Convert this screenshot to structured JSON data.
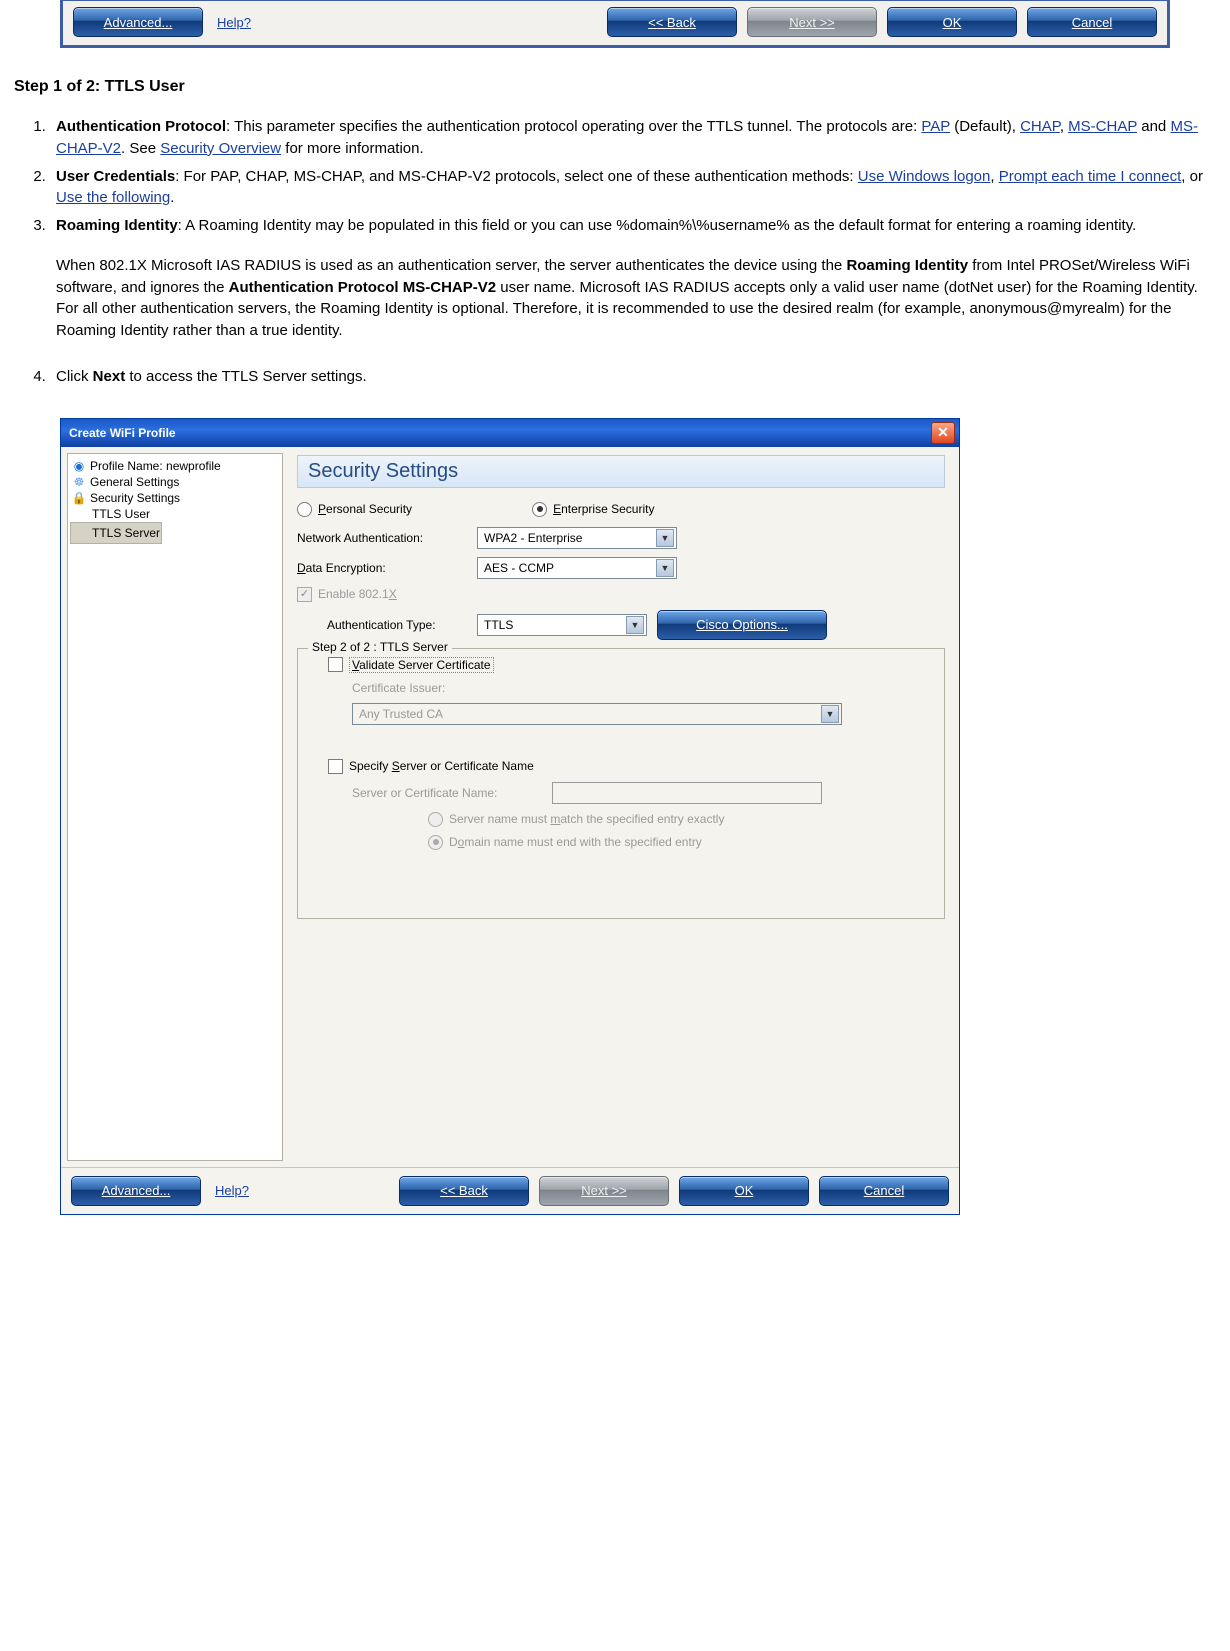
{
  "top_toolbar": {
    "advanced": "Advanced...",
    "help": "Help?",
    "back": "<< Back",
    "next": "Next >>",
    "ok": "OK",
    "cancel": "Cancel"
  },
  "doc": {
    "step_heading": "Step 1 of 2: TTLS User",
    "item1_label": "Authentication Protocol",
    "item1_text_a": ": This parameter specifies the authentication protocol operating over the TTLS tunnel. The protocols are: ",
    "item1_link_pap": "PAP",
    "item1_text_b": " (Default), ",
    "item1_link_chap": "CHAP",
    "item1_text_c": ", ",
    "item1_link_mschap": "MS-CHAP",
    "item1_text_d": " and ",
    "item1_link_mschapv2": "MS-CHAP-V2",
    "item1_text_e": ". See ",
    "item1_link_sec": "Security Overview",
    "item1_text_f": " for more information.",
    "item2_label": "User Credentials",
    "item2_text_a": ": For PAP, CHAP, MS-CHAP, and MS-CHAP-V2 protocols, select one of these authentication methods: ",
    "item2_link_a": "Use Windows logon",
    "item2_text_b": ", ",
    "item2_link_b": "Prompt each time I connect",
    "item2_text_c": ", or ",
    "item2_link_c": "Use the following",
    "item2_text_d": ".",
    "item3_label": "Roaming Identity",
    "item3_text_a": ": A Roaming Identity may be populated in this field or you can use %domain%\\%username% as the default format for entering a roaming identity.",
    "item3_para2_a": "When 802.1X Microsoft IAS RADIUS is used as an authentication server, the server authenticates the device using the ",
    "item3_para2_b_bold": "Roaming Identity",
    "item3_para2_c": " from Intel PROSet/Wireless WiFi software, and ignores the ",
    "item3_para2_d_bold": "Authentication Protocol MS-CHAP-V2",
    "item3_para2_e": " user name. Microsoft IAS RADIUS accepts only a valid user name (dotNet user) for the Roaming Identity. For all other authentication servers, the Roaming Identity is optional. Therefore, it is recommended to use the desired realm (for example, anonymous@myrealm) for the Roaming Identity rather than a true identity.",
    "item4_a": "Click ",
    "item4_b_bold": "Next",
    "item4_c": " to access the TTLS Server settings."
  },
  "dialog": {
    "title": "Create WiFi Profile",
    "tree": {
      "profile": "Profile Name: newprofile",
      "general": "General Settings",
      "security": "Security Settings",
      "ttls_user": "TTLS User",
      "ttls_server": "TTLS Server"
    },
    "panel_title": "Security Settings",
    "radio_personal": "Personal Security",
    "radio_enterprise": "Enterprise Security",
    "lbl_netauth": "Network Authentication:",
    "val_netauth": "WPA2 - Enterprise",
    "lbl_dataenc": "Data Encryption:",
    "val_dataenc": "AES - CCMP",
    "chk_8021x": "Enable 802.1X",
    "lbl_authtype": "Authentication Type:",
    "val_authtype": "TTLS",
    "btn_cisco": "Cisco Options...",
    "fieldset_legend": "Step 2 of 2 : TTLS Server",
    "chk_validate": "Validate Server Certificate",
    "lbl_issuer": "Certificate Issuer:",
    "val_issuer": "Any Trusted CA",
    "chk_specify": "Specify Server or Certificate Name",
    "lbl_servname": "Server or Certificate Name:",
    "radio_match": "Server name must match the specified entry exactly",
    "radio_endwith": "Domain name must end with the specified entry"
  },
  "bottom_toolbar": {
    "advanced": "Advanced...",
    "help": "Help?",
    "back": "<< Back",
    "next": "Next >>",
    "ok": "OK",
    "cancel": "Cancel"
  }
}
